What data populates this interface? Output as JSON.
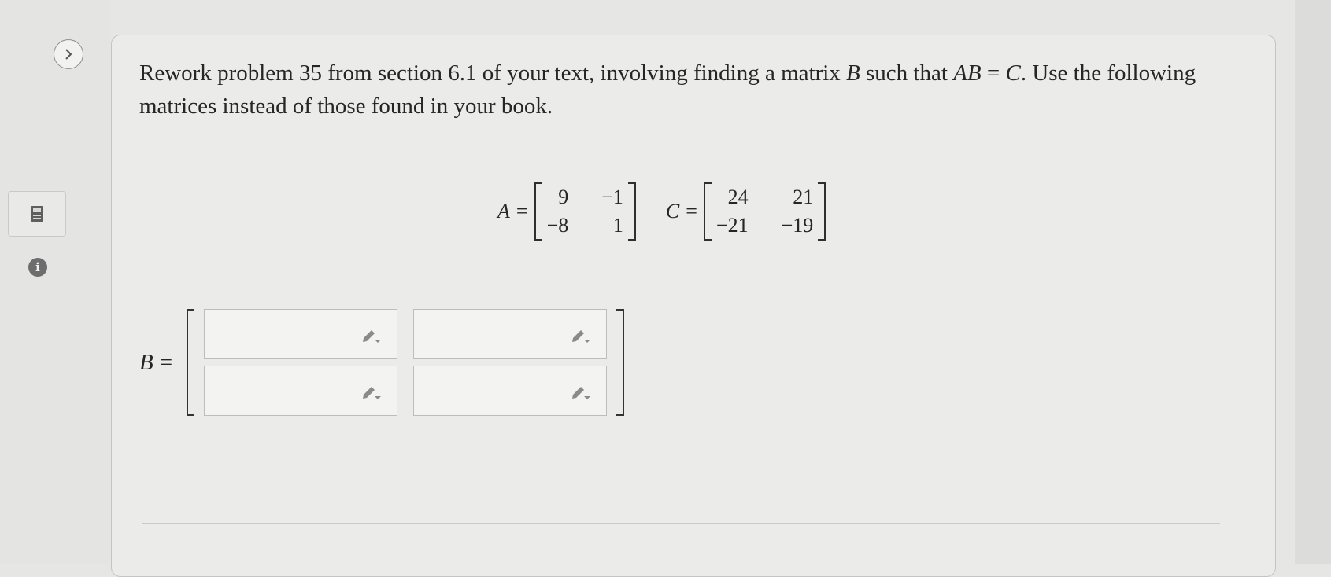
{
  "question": {
    "text_before_B": "Rework problem 35 from section 6.1 of your text, involving finding a matrix ",
    "var_B": "B",
    "text_such_that": " such that ",
    "eq_lhs": "AB",
    "eq_sign": " = ",
    "eq_rhs": "C",
    "text_after": ". Use the following matrices instead of those found in your book."
  },
  "matrix_A": {
    "label": "A",
    "equals": "=",
    "values": [
      [
        "9",
        "−1"
      ],
      [
        "−8",
        "1"
      ]
    ]
  },
  "matrix_C": {
    "label": "C",
    "equals": "=",
    "values": [
      [
        "24",
        "21"
      ],
      [
        "−21",
        "−19"
      ]
    ]
  },
  "answer": {
    "label": "B",
    "equals": "=",
    "cells": [
      [
        "",
        ""
      ],
      [
        "",
        ""
      ]
    ]
  },
  "sidebar": {
    "expand_icon": "chevron-right-icon",
    "calculator_icon": "calculator-icon",
    "info_glyph": "i"
  },
  "icons": {
    "cell_edit": "pencil-dropdown-icon"
  }
}
